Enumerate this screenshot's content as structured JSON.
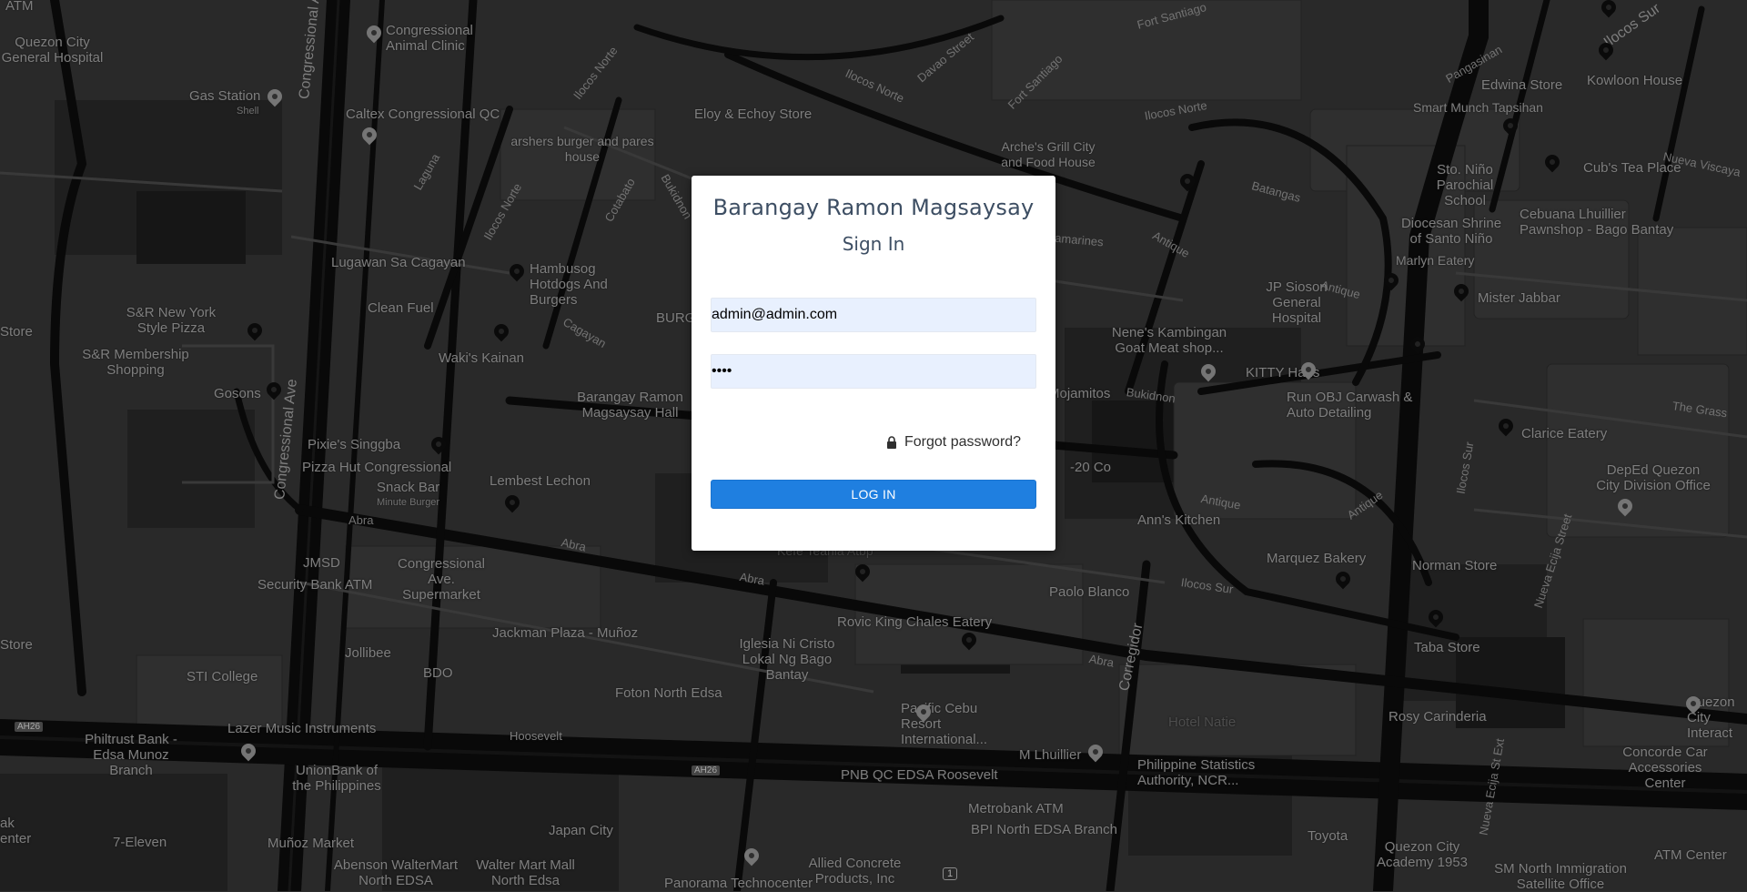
{
  "login": {
    "org_name": "Barangay Ramon Magsaysay",
    "heading": "Sign In",
    "email_value": "admin@admin.com",
    "password_value": "••••",
    "forgot_label": "Forgot password?",
    "login_label": "LOG IN",
    "accent_color": "#1f7fe0",
    "icons": [
      "lock-icon"
    ]
  },
  "map": {
    "places": [
      "Quezon City General Hospital",
      "Congressional Animal Clinic",
      "Gas Station",
      "Shell",
      "Caltex Congressional QC",
      "Eloy & Echoy Store",
      "arshers burger and pares house",
      "Arche's Grill City and Food House",
      "Edwina Store",
      "Kowloon House",
      "Smart Munch Tapsihan",
      "Sto. Niño Parochial School",
      "Cub's Tea Place",
      "Cebuana Lhuillier Pawnshop - Bago Bantay",
      "Diocesan Shrine of Santo Niño",
      "Marlyn Eatery",
      "Mister Jabbar",
      "JP Sioson General Hospital",
      "Nene's Kambingan Goat Meat shop...",
      "Run OBJ Carwash & Auto Detailing",
      "KITTY Haus",
      "Clarice Eatery",
      "DepEd Quezon City Division Office",
      "Lugawan Sa Cagayan",
      "Clean Fuel",
      "Hambusog Hotdogs And Burgers",
      "S&R New York Style Pizza",
      "S&R Membership Shopping",
      "Waki's Kainan",
      "Gosons",
      "Barangay Ramon Magsaysay Hall",
      "Pixie's Singgba",
      "Pizza Hut Congressional",
      "Snack Bar",
      "Minute Burger",
      "Lembest Lechon",
      "Mojamitos",
      "Ann's Kitchen",
      "Kefe Teahia Atbp",
      "Marquez Bakery",
      "Norman Store",
      "Paolo Blanco",
      "JMSD",
      "Security Bank ATM",
      "Congressional Ave. Supermarket",
      "Rovic King Chales Eatery",
      "Taba Store",
      "Jackman Plaza - Muñoz",
      "Iglesia Ni Cristo Lokal Ng Bago Bantay",
      "Jollibee",
      "BDO",
      "STI College",
      "Foton North Edsa",
      "Pacific Cebu Resort International...",
      "Rosy Carinderia",
      "Quezon City Interact",
      "Lazer Music Instruments",
      "Philtrust Bank - Edsa Munoz Branch",
      "Hoosevelt",
      "M Lhuillier",
      "Philippine Statistics Authority, NCR...",
      "Concorde Car Accessories Center",
      "UnionBank of the Philippines",
      "PNB QC EDSA Roosevelt",
      "Metrobank ATM",
      "BPI North EDSA Branch",
      "7-Eleven",
      "Muñoz Market",
      "Japan City",
      "Toyota",
      "Quezon City Academy 1953",
      "ATM Center",
      "Abenson WalterMart North EDSA",
      "Walter Mart Mall North Edsa",
      "Panorama Technocenter",
      "Allied Concrete Products, Inc",
      "SM North Immigration Satellite Office",
      "ATM",
      "Store",
      "Store",
      "ak enter",
      "BURG",
      "Hotel Natie",
      "-20 Co"
    ],
    "streets": [
      "Congressional Ave",
      "Congressional Ave",
      "Ilocos Norte",
      "Ilocos Norte",
      "Ilocos Norte",
      "Ilocos Norte",
      "Davao Street",
      "Fort Santiago",
      "Fort Santiago",
      "Pangasinan",
      "Ilocos Sur",
      "Nueva Viscaya",
      "Laguna",
      "Cotabato",
      "Bukidnon",
      "Bukidnon",
      "Cagayan",
      "Batangas",
      "Antique",
      "Antique",
      "Antique",
      "Antique",
      "Camarines",
      "Ilocos Sur",
      "Nueva Ecija Street",
      "The Grass",
      "Abra",
      "Abra",
      "Abra",
      "Abra",
      "Ilocos Sur",
      "Corregidor",
      "Nueva Ecija St Ext",
      "AH26",
      "AH26",
      "1"
    ]
  }
}
